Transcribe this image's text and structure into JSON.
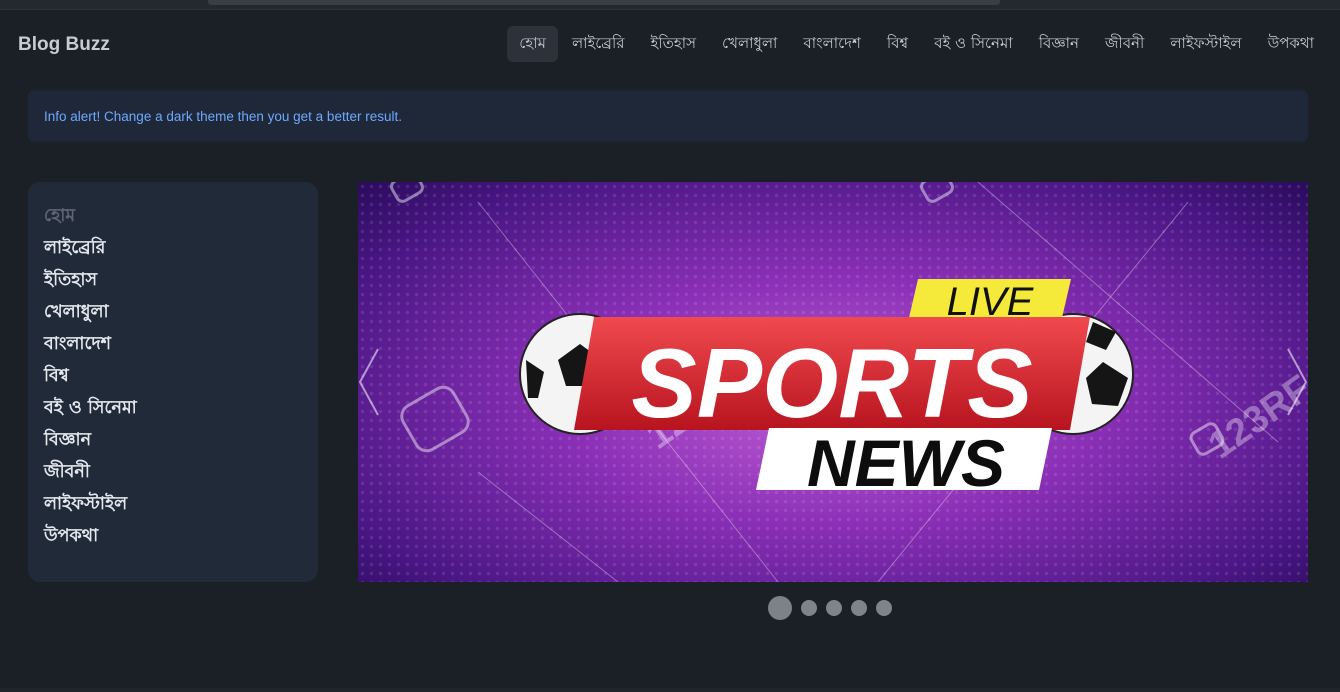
{
  "brand": "Blog Buzz",
  "nav": {
    "items": [
      "হোম",
      "লাইব্রেরি",
      "ইতিহাস",
      "খেলাধুলা",
      "বাংলাদেশ",
      "বিশ্ব",
      "বই ও সিনেমা",
      "বিজ্ঞান",
      "জীবনী",
      "লাইফস্টাইল",
      "উপকথা"
    ],
    "active_index": 0
  },
  "alert": {
    "text": "Info alert! Change a dark theme then you get a better result."
  },
  "sidebar": {
    "items": [
      "হোম",
      "লাইব্রেরি",
      "ইতিহাস",
      "খেলাধুলা",
      "বাংলাদেশ",
      "বিশ্ব",
      "বই ও সিনেমা",
      "বিজ্ঞান",
      "জীবনী",
      "লাইফস্টাইল",
      "উপকথা"
    ]
  },
  "carousel": {
    "slide": {
      "badge_top": "LIVE",
      "headline": "SPORTS",
      "subline": "NEWS",
      "watermark": "123RF"
    },
    "slide_count": 5,
    "active_slide": 0
  },
  "colors": {
    "background": "#1b1f26",
    "accent_blue": "#6ea8fe",
    "sports_red": "#e0303a",
    "live_yellow": "#f5ea3a"
  }
}
